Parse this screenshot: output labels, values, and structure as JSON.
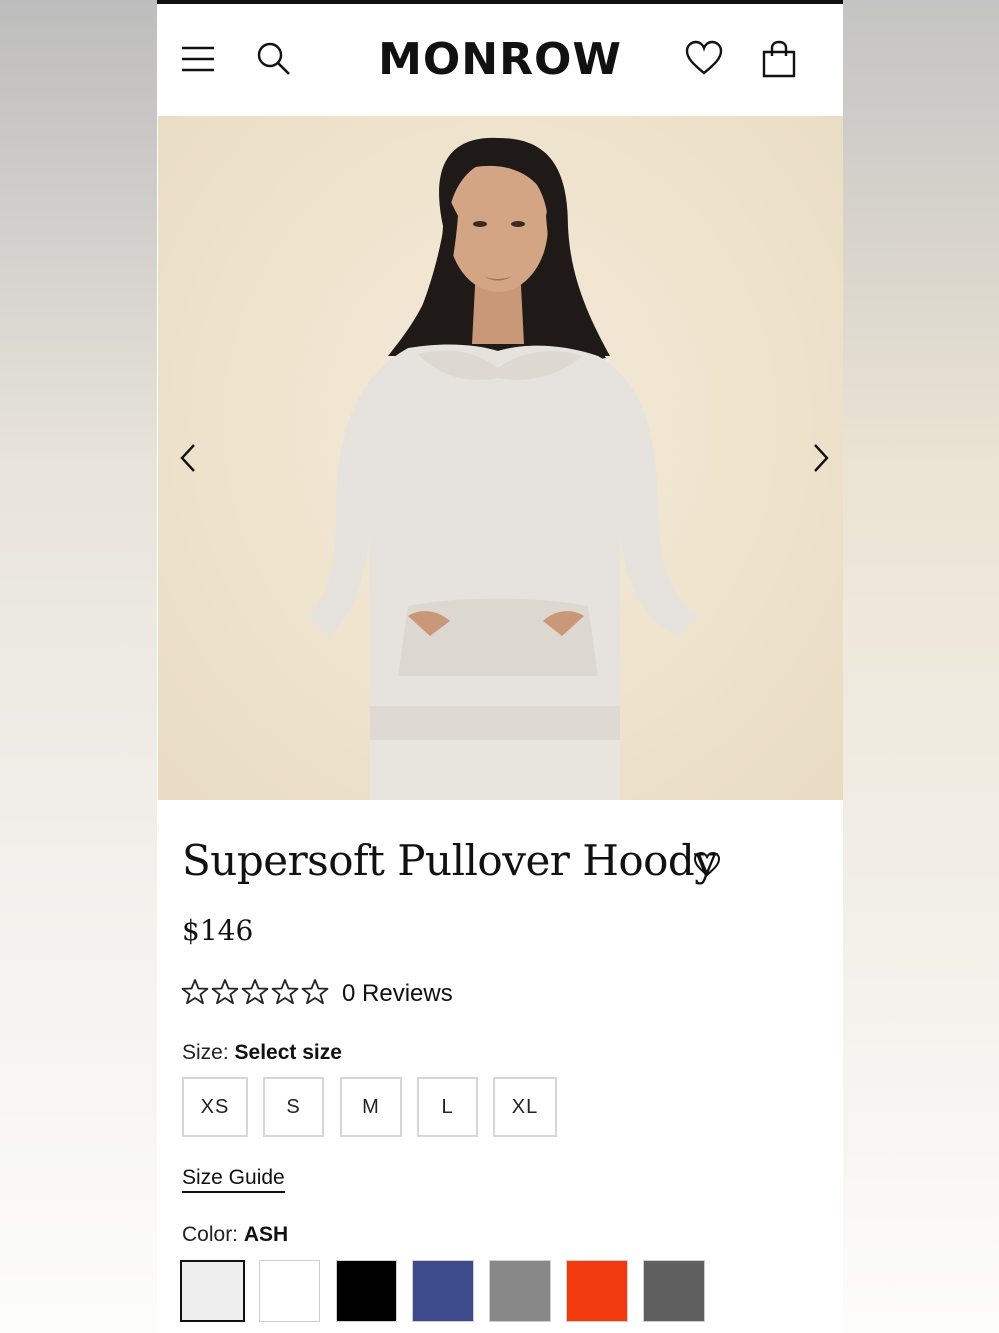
{
  "header": {
    "logo": "MONROW",
    "menu_icon": "hamburger-menu-icon",
    "search_icon": "search-icon",
    "wishlist_icon": "heart-icon",
    "bag_icon": "shopping-bag-icon"
  },
  "gallery": {
    "prev_icon": "chevron-left-icon",
    "next_icon": "chevron-right-icon",
    "image_subject": "model-in-hoody"
  },
  "product": {
    "title": "Supersoft Pullover Hoody",
    "price": "$146",
    "rating": 0,
    "rating_max": 5,
    "reviews": "0 Reviews"
  },
  "size": {
    "label": "Size:",
    "value": "Select size",
    "options": [
      "XS",
      "S",
      "M",
      "L",
      "XL"
    ],
    "guide": "Size Guide"
  },
  "color": {
    "label": "Color:",
    "value": "ASH",
    "swatches": [
      "#eeeeee",
      "#ffffff",
      "#000000",
      "#3d4a8c",
      "#888888",
      "#f23a0f",
      "#5f5f5f"
    ],
    "selected_index": 0
  }
}
